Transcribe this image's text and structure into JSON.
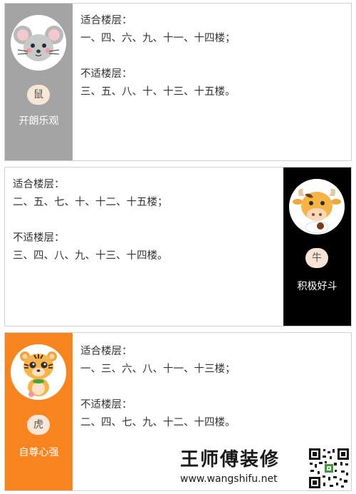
{
  "cards": [
    {
      "zodiac": "鼠",
      "motto": "开朗乐观",
      "suitable_label": "适合楼层：",
      "suitable_value": "一、四、六、九、十一、十四楼；",
      "unsuitable_label": "不适楼层：",
      "unsuitable_value": "三、五、八、十、十三、十五楼。",
      "side_color": "#a4a4a4",
      "icon": "mouse-icon"
    },
    {
      "zodiac": "牛",
      "motto": "积极好斗",
      "suitable_label": "适合楼层：",
      "suitable_value": "二、五、七、十、十二、十五楼；",
      "unsuitable_label": "不适楼层：",
      "unsuitable_value": "三、四、八、九、十三、十四楼。",
      "side_color": "#000000",
      "icon": "ox-icon"
    },
    {
      "zodiac": "虎",
      "motto": "自尊心强",
      "suitable_label": "适合楼层：",
      "suitable_value": "一、三、六、八、十一、十三楼；",
      "unsuitable_label": "不适楼层：",
      "unsuitable_value": "二、四、七、九、十二、十四楼。",
      "side_color": "#f7841f",
      "icon": "tiger-icon"
    }
  ],
  "watermark": {
    "title": "王师傅装修",
    "url": "www.wangshifu.net",
    "icon": "qr-code-icon"
  }
}
